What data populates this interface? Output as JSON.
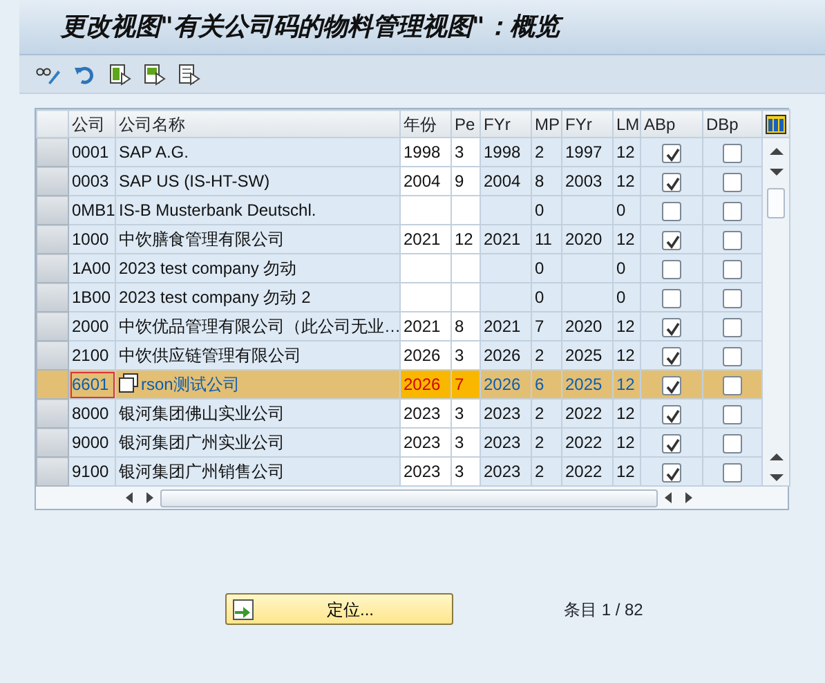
{
  "window": {
    "title": "更改视图\"有关公司码的物料管理视图\"：概览"
  },
  "table": {
    "columns": [
      "公司",
      "公司名称",
      "年份",
      "Pe",
      "FYr",
      "MP",
      "FYr",
      "LM",
      "ABp",
      "DBp"
    ],
    "rows": [
      {
        "cells": [
          "0001",
          "SAP A.G.",
          "1998",
          "3",
          "1998",
          "2",
          "1997",
          "12"
        ],
        "abp": true,
        "dbp": false,
        "selected": false,
        "focused": false
      },
      {
        "cells": [
          "0003",
          "SAP US (IS-HT-SW)",
          "2004",
          "9",
          "2004",
          "8",
          "2003",
          "12"
        ],
        "abp": true,
        "dbp": false,
        "selected": false,
        "focused": false
      },
      {
        "cells": [
          "0MB1",
          "IS-B Musterbank Deutschl.",
          null,
          null,
          null,
          "0",
          null,
          "0"
        ],
        "abp": false,
        "dbp": false,
        "selected": false,
        "focused": false
      },
      {
        "cells": [
          "1000",
          "中饮膳食管理有限公司",
          "2021",
          "12",
          "2021",
          "11",
          "2020",
          "12"
        ],
        "abp": true,
        "dbp": false,
        "selected": false,
        "focused": false
      },
      {
        "cells": [
          "1A00",
          "2023 test company 勿动",
          null,
          null,
          null,
          "0",
          null,
          "0"
        ],
        "abp": false,
        "dbp": false,
        "selected": false,
        "focused": false
      },
      {
        "cells": [
          "1B00",
          "2023 test company 勿动 2",
          null,
          null,
          null,
          "0",
          null,
          "0"
        ],
        "abp": false,
        "dbp": false,
        "selected": false,
        "focused": false
      },
      {
        "cells": [
          "2000",
          "中饮优品管理有限公司（此公司无业…",
          "2021",
          "8",
          "2021",
          "7",
          "2020",
          "12"
        ],
        "abp": true,
        "dbp": false,
        "selected": false,
        "focused": false
      },
      {
        "cells": [
          "2100",
          "中饮供应链管理有限公司",
          "2026",
          "3",
          "2026",
          "2",
          "2025",
          "12"
        ],
        "abp": true,
        "dbp": false,
        "selected": false,
        "focused": false
      },
      {
        "cells": [
          "6601",
          "rson测试公司",
          "2026",
          "7",
          "2026",
          "6",
          "2025",
          "12"
        ],
        "abp": true,
        "dbp": false,
        "selected": true,
        "focused": true
      },
      {
        "cells": [
          "8000",
          "银河集团佛山实业公司",
          "2023",
          "3",
          "2023",
          "2",
          "2022",
          "12"
        ],
        "abp": true,
        "dbp": false,
        "selected": false,
        "focused": false
      },
      {
        "cells": [
          "9000",
          "银河集团广州实业公司",
          "2023",
          "3",
          "2023",
          "2",
          "2022",
          "12"
        ],
        "abp": true,
        "dbp": false,
        "selected": false,
        "focused": false
      },
      {
        "cells": [
          "9100",
          "银河集团广州销售公司",
          "2023",
          "3",
          "2023",
          "2",
          "2022",
          "12"
        ],
        "abp": true,
        "dbp": false,
        "selected": false,
        "focused": false
      }
    ]
  },
  "position_button": "定位...",
  "entry_count": "条目 1 / 82"
}
